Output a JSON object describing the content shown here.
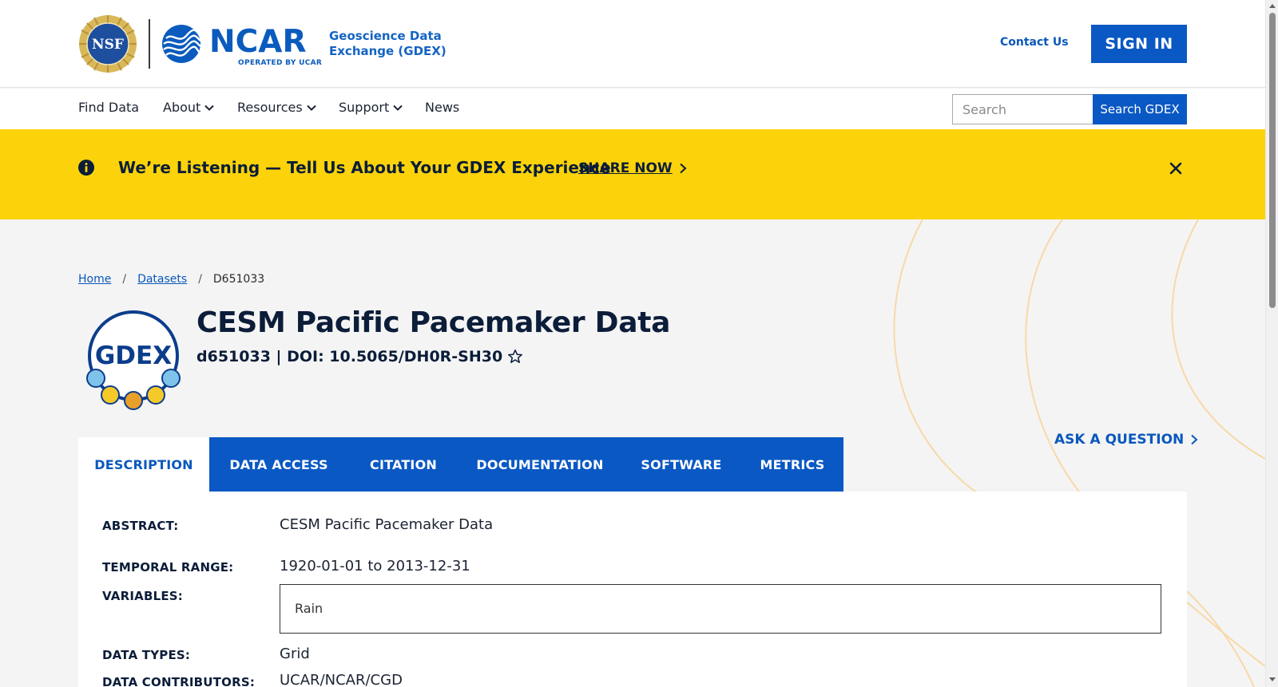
{
  "header": {
    "nsf_text": "NSF",
    "ncar_text": "NCAR",
    "ncar_sub": "OPERATED BY UCAR",
    "gdex_name": "Geoscience Data Exchange (GDEX)",
    "contact_label": "Contact Us",
    "signin_label": "SIGN IN"
  },
  "nav": {
    "items": [
      {
        "label": "Find Data"
      },
      {
        "label": "About"
      },
      {
        "label": "Resources"
      },
      {
        "label": "Support"
      },
      {
        "label": "News"
      }
    ],
    "search_placeholder": "Search",
    "search_button": "Search GDEX"
  },
  "banner": {
    "text": "We’re Listening — Tell Us About Your GDEX Experience",
    "share_label": "SHARE NOW"
  },
  "breadcrumb": {
    "home": "Home",
    "sep": "/",
    "datasets": "Datasets",
    "current": "D651033"
  },
  "dataset": {
    "logo_text": "GDEX",
    "title": "CESM Pacific Pacemaker Data",
    "subtitle": "d651033 | DOI: 10.5065/DH0R-SH30",
    "ask_label": "ASK A QUESTION"
  },
  "tabs": [
    {
      "label": "DESCRIPTION"
    },
    {
      "label": "DATA ACCESS"
    },
    {
      "label": "CITATION"
    },
    {
      "label": "DOCUMENTATION"
    },
    {
      "label": "SOFTWARE"
    },
    {
      "label": "METRICS"
    }
  ],
  "details": {
    "abstract_label": "ABSTRACT:",
    "abstract_value": "CESM Pacific Pacemaker Data",
    "temporal_label": "TEMPORAL RANGE:",
    "temporal_value": "1920-01-01 to 2013-12-31",
    "variables_label": "VARIABLES:",
    "variables_value": "Rain",
    "datatypes_label": "DATA TYPES:",
    "datatypes_value": "Grid",
    "contributors_label": "DATA CONTRIBUTORS:",
    "contributors_value": "UCAR/NCAR/CGD"
  },
  "colors": {
    "brand_blue": "#0a58c4",
    "banner_yellow": "#fcd30a",
    "navy_text": "#0b1d39"
  }
}
